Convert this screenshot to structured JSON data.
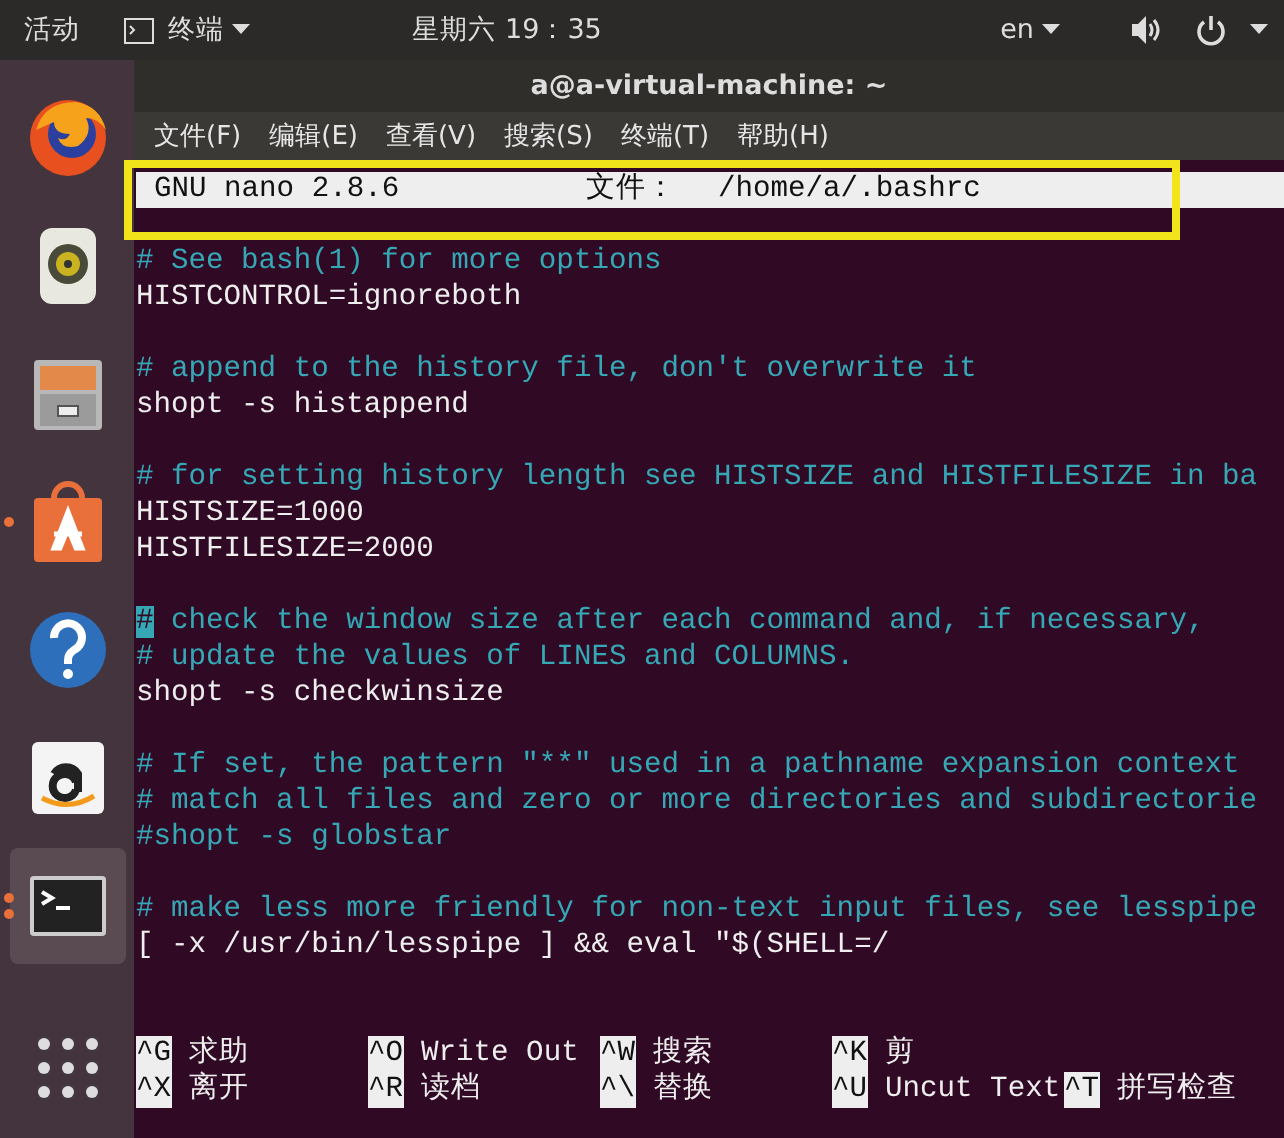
{
  "top_bar": {
    "activities": "活动",
    "app_menu": "终端",
    "clock": "星期六 19：35",
    "keyboard": "en"
  },
  "dock": [
    {
      "kind": "firefox",
      "running": false,
      "selected": false
    },
    {
      "kind": "speaker",
      "running": false,
      "selected": false
    },
    {
      "kind": "files",
      "running": false,
      "selected": false
    },
    {
      "kind": "store",
      "running": true,
      "selected": false
    },
    {
      "kind": "help",
      "running": false,
      "selected": false
    },
    {
      "kind": "amazon",
      "running": false,
      "selected": false
    },
    {
      "kind": "terminal",
      "running": true,
      "selected": true
    },
    {
      "kind": "apps",
      "running": false,
      "selected": false
    }
  ],
  "window": {
    "title": "a@a-virtual-machine: ~"
  },
  "menu": [
    "文件(F)",
    "编辑(E)",
    "查看(V)",
    "搜索(S)",
    "终端(T)",
    "帮助(H)"
  ],
  "nano_header": {
    "version": "GNU nano 2.8.6",
    "file_label": "文件：",
    "file_path": "/home/a/.bashrc"
  },
  "lines": [
    {
      "kind": "comment",
      "text": "# See bash(1) for more options"
    },
    {
      "kind": "code",
      "text": "HISTCONTROL=ignoreboth"
    },
    {
      "kind": "blank"
    },
    {
      "kind": "comment",
      "text": "# append to the history file, don't overwrite it"
    },
    {
      "kind": "code",
      "text": "shopt -s histappend"
    },
    {
      "kind": "blank"
    },
    {
      "kind": "comment",
      "text": "# for setting history length see HISTSIZE and HISTFILESIZE in ba"
    },
    {
      "kind": "code",
      "text": "HISTSIZE=1000"
    },
    {
      "kind": "code",
      "text": "HISTFILESIZE=2000"
    },
    {
      "kind": "blank"
    },
    {
      "kind": "comment",
      "text": "# check the window size after each command and, if necessary,",
      "cursor": true
    },
    {
      "kind": "comment",
      "text": "# update the values of LINES and COLUMNS."
    },
    {
      "kind": "code",
      "text": "shopt -s checkwinsize"
    },
    {
      "kind": "blank"
    },
    {
      "kind": "comment",
      "text": "# If set, the pattern \"**\" used in a pathname expansion context"
    },
    {
      "kind": "comment",
      "text": "# match all files and zero or more directories and subdirectorie"
    },
    {
      "kind": "comment",
      "text": "#shopt -s globstar"
    },
    {
      "kind": "blank"
    },
    {
      "kind": "comment",
      "text": "# make less more friendly for non-text input files, see lesspipe"
    },
    {
      "kind": "code",
      "text": "[ -x /usr/bin/lesspipe ] && eval \"$(SHELL=/"
    },
    {
      "kind": "blank"
    },
    {
      "kind": "blank"
    }
  ],
  "shortcuts": [
    [
      {
        "key": "^G",
        "label": "求助"
      },
      {
        "key": "^O",
        "label": "Write Out"
      },
      {
        "key": "^W",
        "label": "搜索"
      },
      {
        "key": "^K",
        "label": "剪"
      }
    ],
    [
      {
        "key": "^X",
        "label": "离开"
      },
      {
        "key": "^R",
        "label": "读档"
      },
      {
        "key": "^\\",
        "label": "替换"
      },
      {
        "key": "^U",
        "label": "Uncut Text"
      },
      {
        "key": "^T",
        "label": "拼写检查"
      }
    ]
  ]
}
